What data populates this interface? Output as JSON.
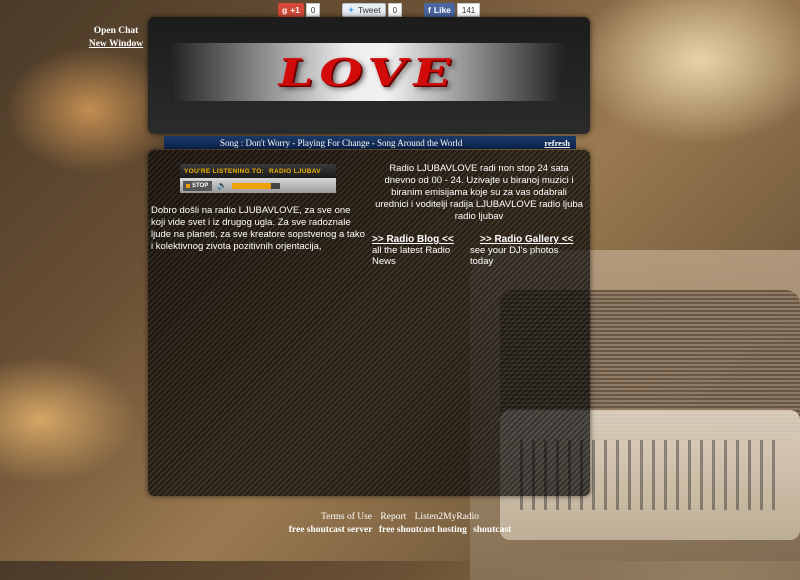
{
  "share": {
    "gplus_label": "+1",
    "gplus_count": "0",
    "tweet_label": "Tweet",
    "tweet_count": "0",
    "fb_label": "Like",
    "fb_count": "141"
  },
  "chat": {
    "open_label": "Open Chat",
    "window_label": "New Window"
  },
  "logo": {
    "text": "LOVE"
  },
  "song": {
    "text": "Song :  Don't Worry - Playing For Change - Song Around the World",
    "refresh_label": "refresh"
  },
  "player": {
    "listening_label": "YOU'RE LISTENING TO:",
    "station": "RADIO LJUBAV",
    "stop_label": "STOP",
    "volume_level": 0.8
  },
  "welcome_text": "Dobro došli na radio LJUBAVLOVE, za sve one koji vide svet i iz drugog ugla. Za sve radoznale ljude na planeti, za sve kreatore sopstvenog a tako i kolektivnog zivota pozitivnih orjentacija,",
  "about_text": "Radio LJUBAVLOVE radi non stop 24 sata dnevno od 00 - 24. Uzivajte u biranoj muzici i biranim emisijama koje su za vas odabrali urednici i voditelji radija LJUBAVLOVE radio ljuba radio ljubav",
  "links": {
    "blog_label": ">> Radio Blog <<",
    "blog_desc": "all the latest Radio News",
    "gallery_label": ">> Radio Gallery <<",
    "gallery_desc": "see your DJ's photos today"
  },
  "footer": {
    "terms": "Terms of Use",
    "report": "Report",
    "l2m": "Listen2MyRadio",
    "free_server": "free shoutcast server",
    "free_hosting": "free shoutcast hosting",
    "shoutcast": "shoutcast"
  },
  "colors": {
    "logo_red": "#d10a0a",
    "song_bar_blue": "#0c2450",
    "player_accent": "#f0a000"
  }
}
